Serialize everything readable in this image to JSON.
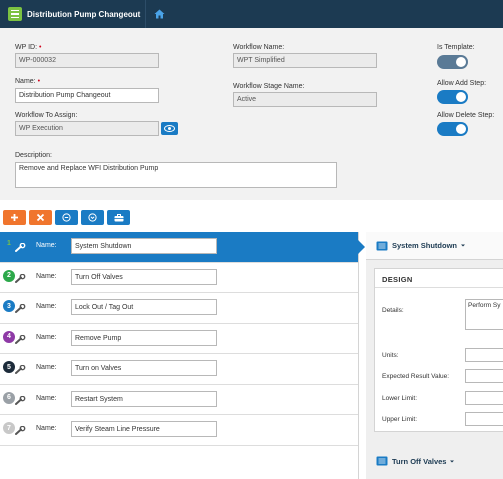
{
  "app": {
    "title": "Distribution Pump Changeout"
  },
  "form": {
    "wp_id_label": "WP ID:",
    "wp_id_value": "WP-000032",
    "name_label": "Name:",
    "name_value": "Distribution Pump Changeout",
    "workflow_assign_label": "Workflow To Assign:",
    "workflow_assign_value": "WP Execution",
    "description_label": "Description:",
    "description_value": "Remove and Replace WFI Distribution Pump",
    "workflow_name_label": "Workflow Name:",
    "workflow_name_value": "WPT Simplified",
    "workflow_stage_label": "Workflow Stage Name:",
    "workflow_stage_value": "Active",
    "required_mark": "•",
    "is_template_label": "Is Template:",
    "allow_add_step_label": "Allow Add Step:",
    "allow_delete_step_label": "Allow Delete Step:",
    "is_template_on": false,
    "allow_add_step_on": true,
    "allow_delete_step_on": true
  },
  "toolbar": {
    "buttons": [
      "add-icon",
      "delete-icon",
      "collapse-icon",
      "expand-icon",
      "toolbox-icon"
    ]
  },
  "steps": {
    "name_label": "Name:",
    "items": [
      {
        "num": "1",
        "name": "System Shutdown",
        "color": "#7cc242",
        "active": true
      },
      {
        "num": "2",
        "name": "Turn Off Valves",
        "color": "#2ca84a"
      },
      {
        "num": "3",
        "name": "Lock Out / Tag Out",
        "color": "#1a7bc4"
      },
      {
        "num": "4",
        "name": "Remove Pump",
        "color": "#8e3aa6"
      },
      {
        "num": "5",
        "name": "Turn on Valves",
        "color": "#1c2b3a"
      },
      {
        "num": "6",
        "name": "Restart System",
        "color": "#9aa0a6"
      },
      {
        "num": "7",
        "name": "Verify Steam Line Pressure",
        "color": "#c8c8c8"
      }
    ]
  },
  "detail": {
    "title": "System Shutdown",
    "section": "DESIGN",
    "details_label": "Details:",
    "details_value": "Perform Sy",
    "units_label": "Units:",
    "expected_label": "Expected Result Value:",
    "lower_label": "Lower Limit:",
    "upper_label": "Upper Limit:",
    "next_title": "Turn Off Valves"
  }
}
